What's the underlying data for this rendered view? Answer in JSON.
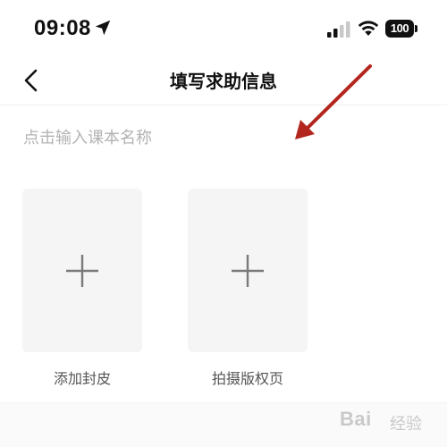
{
  "status_bar": {
    "time": "09:08",
    "battery": "100",
    "icons": [
      "location-arrow-icon",
      "cellular-signal-icon",
      "wifi-icon",
      "battery-icon"
    ]
  },
  "nav": {
    "title": "填写求助信息",
    "back_icon": "chevron-left-icon"
  },
  "form": {
    "textbook_name_placeholder": "点击输入课本名称",
    "textbook_name_value": ""
  },
  "uploads": [
    {
      "label": "添加封皮",
      "icon": "plus-icon"
    },
    {
      "label": "拍摄版权页",
      "icon": "plus-icon"
    }
  ],
  "annotation": {
    "color": "#b3261e",
    "icon": "red-arrow"
  },
  "watermark": {
    "text": "Bai",
    "sub": "经验"
  }
}
